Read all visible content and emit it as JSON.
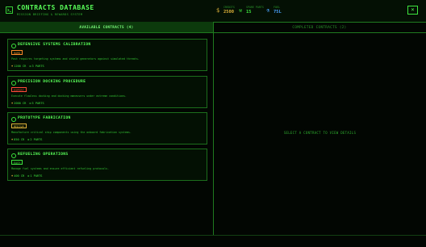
{
  "colors": {
    "accent": "#3ee53e",
    "background": "#020602",
    "gold": "#e0b33a"
  },
  "header": {
    "title": "CONTRACTS DATABASE",
    "subtitle": "MISSION BRIEFING & REWARDS SYSTEM",
    "logo_icon": "terminal-square-icon",
    "stats": [
      {
        "icon": "dollar-icon",
        "label": "CREDITS",
        "value": "2500",
        "color": "#e0b33a"
      },
      {
        "icon": "wrench-icon",
        "label": "SPARE PARTS",
        "value": "15",
        "color": "#3ee53e"
      },
      {
        "icon": "flask-icon",
        "label": "FUEL",
        "value": "75L",
        "color": "#4aa3ff"
      }
    ],
    "close_label": "×"
  },
  "tabs": {
    "available": "AVAILABLE CONTRACTS (4)",
    "completed": "COMPLETED CONTRACTS (2)"
  },
  "contracts": [
    {
      "name": "DEFENSIVE SYSTEMS CALIBRATION",
      "difficulty": "HARD",
      "difficulty_color": "#ff8a2a",
      "description": "Post requires targeting systems and shield generators against simulated threats.",
      "credits": "1200 CR",
      "parts": "3 PARTS"
    },
    {
      "name": "PRECISION DOCKING PROCEDURE",
      "difficulty": "EXPERT",
      "difficulty_color": "#ff4a3a",
      "description": "Execute flawless docking and docking maneuvers under extreme conditions.",
      "credits": "2000 CR",
      "parts": "5 PARTS"
    },
    {
      "name": "PROTOTYPE FABRICATION",
      "difficulty": "MEDIUM",
      "difficulty_color": "#e0b33a",
      "description": "Manufacture critical ship components using the onboard fabrication systems.",
      "credits": "850 CR",
      "parts": "2 PARTS"
    },
    {
      "name": "REFUELING OPERATIONS",
      "difficulty": "EASY",
      "difficulty_color": "#3ee53e",
      "description": "Manage fuel systems and ensure efficient refueling protocols.",
      "credits": "400 CR",
      "parts": "1 PARTS"
    }
  ],
  "detail": {
    "empty_message": "SELECT A CONTRACT TO VIEW DETAILS"
  }
}
